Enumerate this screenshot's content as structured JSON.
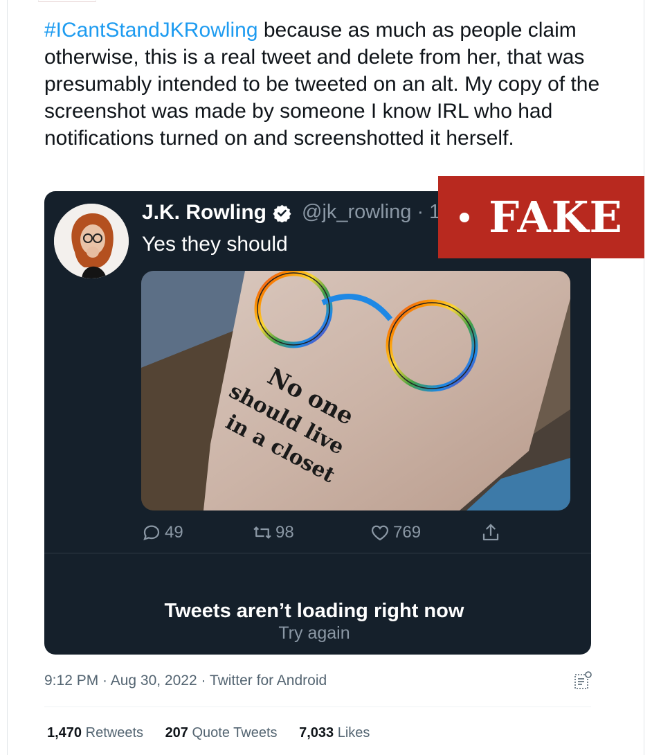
{
  "tweet": {
    "hashtag": "#ICantStandJKRowling",
    "body": " because as much as people claim otherwise, this is a real tweet and delete from her, that was presumably intended to be tweeted on an alt. My copy of the screenshot was made by someone I know IRL who had notifications turned on and screenshotted it herself."
  },
  "embedded": {
    "name": "J.K. Rowling",
    "handle": "@jk_rowling · 1",
    "text": "Yes they should",
    "tattoo_lines": [
      "No one",
      "should live",
      "in a closet"
    ],
    "replies": "49",
    "retweets": "98",
    "likes": "769",
    "error_title": "Tweets aren’t loading right now",
    "error_retry": "Try again"
  },
  "badge": {
    "label": "FAKE",
    "color": "#b8291f"
  },
  "meta": {
    "text": "9:12 PM · Aug 30, 2022 · Twitter for Android"
  },
  "stats": {
    "retweets_count": "1,470",
    "retweets_label": "Retweets",
    "quotes_count": "207",
    "quotes_label": "Quote Tweets",
    "likes_count": "7,033",
    "likes_label": "Likes"
  },
  "colors": {
    "link": "#1d9bf0",
    "embed_bg": "#15202b",
    "secondary_text": "#536471"
  }
}
